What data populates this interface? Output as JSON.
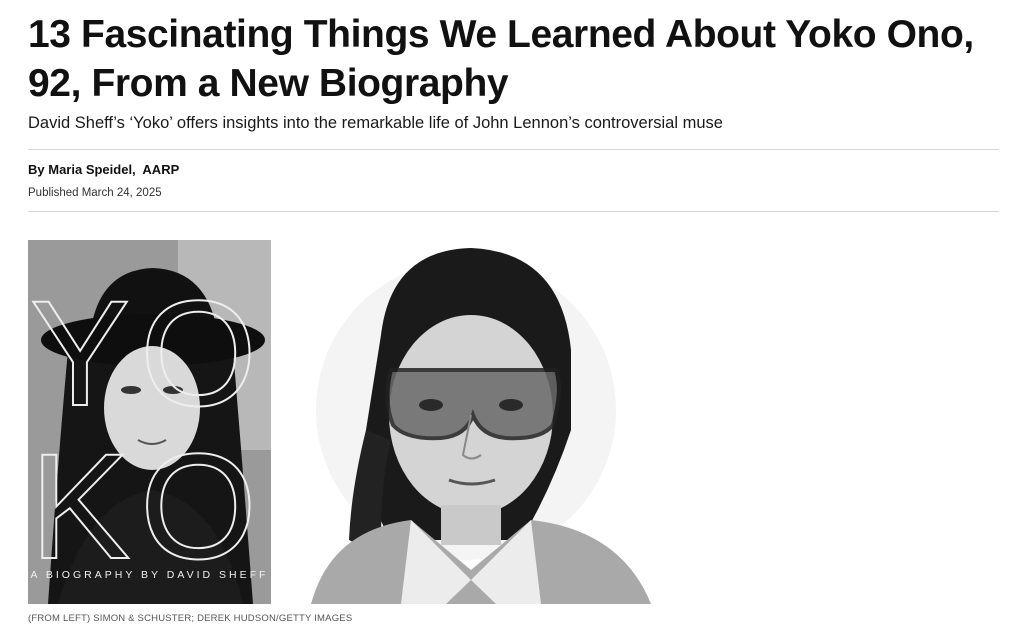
{
  "article": {
    "headline": "13 Fascinating Things We Learned About Yoko Ono, 92, From a New Biography",
    "dek": "David Sheff’s ‘Yoko’ offers insights into the remarkable life of John Lennon’s controversial muse",
    "byline_prefix": "By",
    "author": "Maria Speidel,",
    "outlet": "AARP",
    "published": "Published March 24, 2025"
  },
  "figure": {
    "cover_letters": [
      "Y",
      "O",
      "K",
      "O"
    ],
    "cover_subtitle": "A BIOGRAPHY BY DAVID SHEFF",
    "caption": "(FROM LEFT) SIMON & SCHUSTER; DEREK HUDSON/GETTY IMAGES"
  }
}
